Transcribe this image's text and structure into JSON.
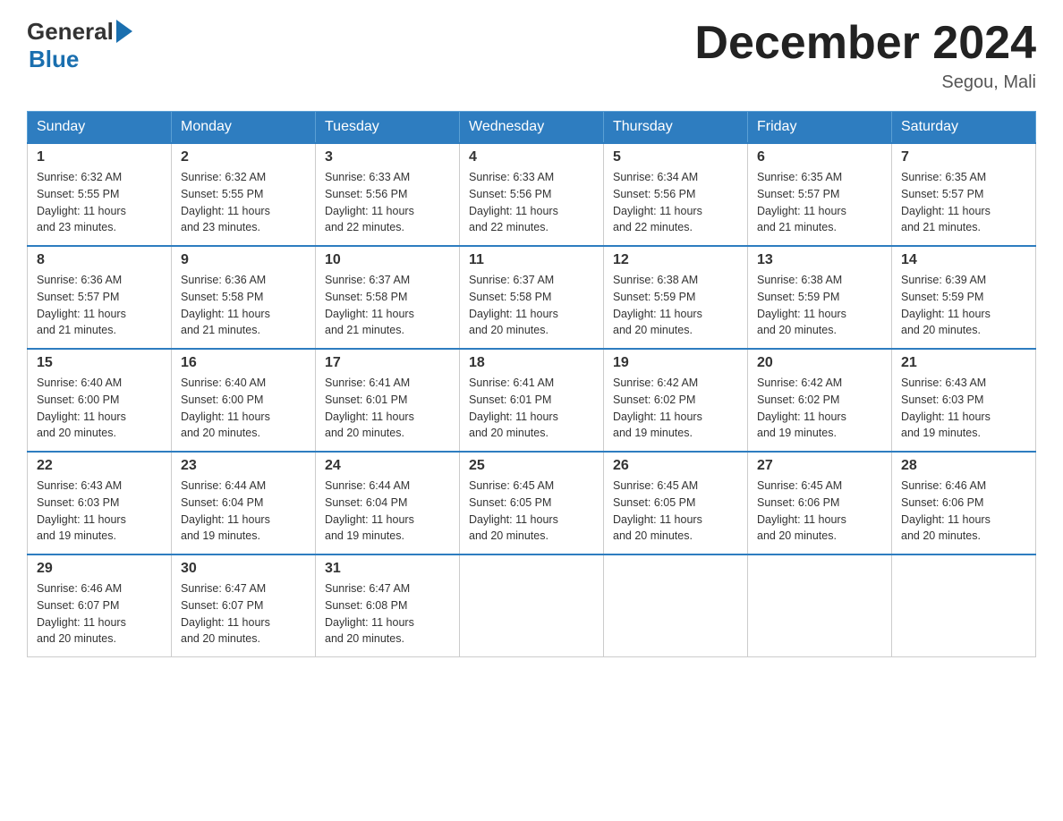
{
  "header": {
    "logo_general": "General",
    "logo_blue": "Blue",
    "title": "December 2024",
    "location": "Segou, Mali"
  },
  "days_of_week": [
    "Sunday",
    "Monday",
    "Tuesday",
    "Wednesday",
    "Thursday",
    "Friday",
    "Saturday"
  ],
  "weeks": [
    [
      {
        "day": "1",
        "sunrise": "6:32 AM",
        "sunset": "5:55 PM",
        "daylight": "11 hours and 23 minutes."
      },
      {
        "day": "2",
        "sunrise": "6:32 AM",
        "sunset": "5:55 PM",
        "daylight": "11 hours and 23 minutes."
      },
      {
        "day": "3",
        "sunrise": "6:33 AM",
        "sunset": "5:56 PM",
        "daylight": "11 hours and 22 minutes."
      },
      {
        "day": "4",
        "sunrise": "6:33 AM",
        "sunset": "5:56 PM",
        "daylight": "11 hours and 22 minutes."
      },
      {
        "day": "5",
        "sunrise": "6:34 AM",
        "sunset": "5:56 PM",
        "daylight": "11 hours and 22 minutes."
      },
      {
        "day": "6",
        "sunrise": "6:35 AM",
        "sunset": "5:57 PM",
        "daylight": "11 hours and 21 minutes."
      },
      {
        "day": "7",
        "sunrise": "6:35 AM",
        "sunset": "5:57 PM",
        "daylight": "11 hours and 21 minutes."
      }
    ],
    [
      {
        "day": "8",
        "sunrise": "6:36 AM",
        "sunset": "5:57 PM",
        "daylight": "11 hours and 21 minutes."
      },
      {
        "day": "9",
        "sunrise": "6:36 AM",
        "sunset": "5:58 PM",
        "daylight": "11 hours and 21 minutes."
      },
      {
        "day": "10",
        "sunrise": "6:37 AM",
        "sunset": "5:58 PM",
        "daylight": "11 hours and 21 minutes."
      },
      {
        "day": "11",
        "sunrise": "6:37 AM",
        "sunset": "5:58 PM",
        "daylight": "11 hours and 20 minutes."
      },
      {
        "day": "12",
        "sunrise": "6:38 AM",
        "sunset": "5:59 PM",
        "daylight": "11 hours and 20 minutes."
      },
      {
        "day": "13",
        "sunrise": "6:38 AM",
        "sunset": "5:59 PM",
        "daylight": "11 hours and 20 minutes."
      },
      {
        "day": "14",
        "sunrise": "6:39 AM",
        "sunset": "5:59 PM",
        "daylight": "11 hours and 20 minutes."
      }
    ],
    [
      {
        "day": "15",
        "sunrise": "6:40 AM",
        "sunset": "6:00 PM",
        "daylight": "11 hours and 20 minutes."
      },
      {
        "day": "16",
        "sunrise": "6:40 AM",
        "sunset": "6:00 PM",
        "daylight": "11 hours and 20 minutes."
      },
      {
        "day": "17",
        "sunrise": "6:41 AM",
        "sunset": "6:01 PM",
        "daylight": "11 hours and 20 minutes."
      },
      {
        "day": "18",
        "sunrise": "6:41 AM",
        "sunset": "6:01 PM",
        "daylight": "11 hours and 20 minutes."
      },
      {
        "day": "19",
        "sunrise": "6:42 AM",
        "sunset": "6:02 PM",
        "daylight": "11 hours and 19 minutes."
      },
      {
        "day": "20",
        "sunrise": "6:42 AM",
        "sunset": "6:02 PM",
        "daylight": "11 hours and 19 minutes."
      },
      {
        "day": "21",
        "sunrise": "6:43 AM",
        "sunset": "6:03 PM",
        "daylight": "11 hours and 19 minutes."
      }
    ],
    [
      {
        "day": "22",
        "sunrise": "6:43 AM",
        "sunset": "6:03 PM",
        "daylight": "11 hours and 19 minutes."
      },
      {
        "day": "23",
        "sunrise": "6:44 AM",
        "sunset": "6:04 PM",
        "daylight": "11 hours and 19 minutes."
      },
      {
        "day": "24",
        "sunrise": "6:44 AM",
        "sunset": "6:04 PM",
        "daylight": "11 hours and 19 minutes."
      },
      {
        "day": "25",
        "sunrise": "6:45 AM",
        "sunset": "6:05 PM",
        "daylight": "11 hours and 20 minutes."
      },
      {
        "day": "26",
        "sunrise": "6:45 AM",
        "sunset": "6:05 PM",
        "daylight": "11 hours and 20 minutes."
      },
      {
        "day": "27",
        "sunrise": "6:45 AM",
        "sunset": "6:06 PM",
        "daylight": "11 hours and 20 minutes."
      },
      {
        "day": "28",
        "sunrise": "6:46 AM",
        "sunset": "6:06 PM",
        "daylight": "11 hours and 20 minutes."
      }
    ],
    [
      {
        "day": "29",
        "sunrise": "6:46 AM",
        "sunset": "6:07 PM",
        "daylight": "11 hours and 20 minutes."
      },
      {
        "day": "30",
        "sunrise": "6:47 AM",
        "sunset": "6:07 PM",
        "daylight": "11 hours and 20 minutes."
      },
      {
        "day": "31",
        "sunrise": "6:47 AM",
        "sunset": "6:08 PM",
        "daylight": "11 hours and 20 minutes."
      },
      null,
      null,
      null,
      null
    ]
  ],
  "labels": {
    "sunrise": "Sunrise:",
    "sunset": "Sunset:",
    "daylight": "Daylight:"
  }
}
